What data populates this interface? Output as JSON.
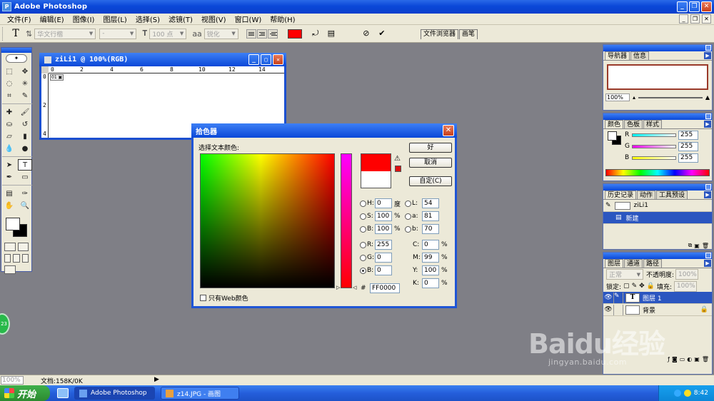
{
  "window": {
    "title": "Adobe Photoshop"
  },
  "menu": [
    "文件(F)",
    "编辑(E)",
    "图像(I)",
    "图层(L)",
    "选择(S)",
    "滤镜(T)",
    "视图(V)",
    "窗口(W)",
    "帮助(H)"
  ],
  "options_bar": {
    "font_family": "华文行楷",
    "font_style": "-",
    "font_size": "100 点",
    "antialias": "锐化",
    "text_color": "#ff0000",
    "tabs": [
      "文件浏览器",
      "画笔"
    ]
  },
  "document": {
    "title": "ziLi1 @ 100%(RGB)",
    "ruler_h": [
      "0",
      "2",
      "4",
      "6",
      "8",
      "10",
      "12",
      "14"
    ],
    "ruler_v": [
      "0",
      "2",
      "4"
    ]
  },
  "color_picker": {
    "title": "拾色器",
    "prompt": "选择文本颜色:",
    "new_color": "#ff0000",
    "old_color": "#ffffff",
    "gamut_color": "#dd1111",
    "buttons": {
      "ok": "好",
      "cancel": "取消",
      "custom": "自定(C)"
    },
    "hsb": {
      "h": "0",
      "s": "100",
      "b": "100",
      "h_unit": "度",
      "s_unit": "%",
      "b_unit": "%"
    },
    "rgb": {
      "r": "255",
      "g": "0",
      "b": "0"
    },
    "lab": {
      "l": "54",
      "a": "81",
      "b": "70"
    },
    "cmyk": {
      "c": "0",
      "m": "99",
      "y": "100",
      "k": "0",
      "unit": "%"
    },
    "hex_label": "#",
    "hex": "FF0000",
    "web_only": "只有Web颜色"
  },
  "panels": {
    "navigator": {
      "tabs": [
        "导航器",
        "信息"
      ],
      "zoom": "100%"
    },
    "color": {
      "tabs": [
        "颜色",
        "色板",
        "样式"
      ],
      "r": "255",
      "g": "255",
      "b": "255"
    },
    "history": {
      "tabs": [
        "历史记录",
        "动作",
        "工具预设"
      ],
      "snapshot": "ziLi1",
      "step": "新建"
    },
    "layers": {
      "tabs": [
        "图层",
        "通道",
        "路径"
      ],
      "blend_mode": "正常",
      "opacity_label": "不透明度:",
      "opacity": "100%",
      "lock_label": "锁定:",
      "fill_label": "填充:",
      "fill": "100%",
      "items": [
        {
          "name": "图层 1",
          "type": "T"
        },
        {
          "name": "背景",
          "type": ""
        }
      ]
    }
  },
  "status": {
    "zoom": "100%",
    "doc": "文档:158K/0K"
  },
  "taskbar": {
    "start": "开始",
    "tasks": [
      "Adobe Photoshop",
      "z14.JPG - 画图"
    ],
    "clock": "8:42"
  },
  "float_badge": "23",
  "watermark": {
    "main": "Baidu经验",
    "sub": "jingyan.baidu.com"
  }
}
